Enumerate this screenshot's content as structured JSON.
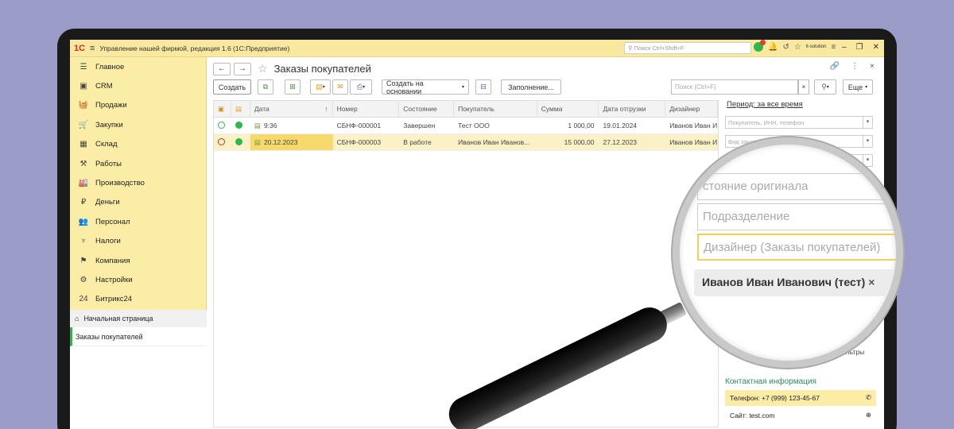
{
  "titlebar": {
    "logo": "1С",
    "app_title": "Управление нашей фирмой, редакция 1.6  (1С:Предприятие)",
    "search_placeholder": "Поиск Ctrl+Shift+F",
    "user": "it-solution"
  },
  "sidebar": {
    "items": [
      {
        "label": "Главное",
        "icon": "☰"
      },
      {
        "label": "CRM",
        "icon": "▣"
      },
      {
        "label": "Продажи",
        "icon": "🧺"
      },
      {
        "label": "Закупки",
        "icon": "🛒"
      },
      {
        "label": "Склад",
        "icon": "▦"
      },
      {
        "label": "Работы",
        "icon": "⚒"
      },
      {
        "label": "Производство",
        "icon": "🏭"
      },
      {
        "label": "Деньги",
        "icon": "₽"
      },
      {
        "label": "Персонал",
        "icon": "👥"
      },
      {
        "label": "Налоги",
        "icon": "♆"
      },
      {
        "label": "Компания",
        "icon": "⚑"
      },
      {
        "label": "Настройки",
        "icon": "⚙"
      },
      {
        "label": "Битрикс24",
        "icon": "24"
      }
    ],
    "home": "Начальная страница",
    "open_tab": "Заказы покупателей"
  },
  "header": {
    "back": "←",
    "forward": "→",
    "title": "Заказы покупателей"
  },
  "toolbar": {
    "create": "Создать",
    "create_based": "Создать на основании",
    "fill": "Заполнение...",
    "search_placeholder": "Поиск (Ctrl+F)",
    "more": "Еще"
  },
  "table": {
    "columns": [
      "",
      "",
      "Дата",
      "Номер",
      "Состояние",
      "Покупатель",
      "Сумма",
      "Дата отгрузки",
      "Дизайнер"
    ],
    "rows": [
      {
        "date": "9:36",
        "number": "СБНФ-000001",
        "status": "Завершен",
        "customer": "Тест  ООО",
        "sum": "1 000,00",
        "ship_date": "19.01.2024",
        "designer": "Иванов Иван И",
        "ring_color": "#2db84c",
        "dot_color": "#2db84c"
      },
      {
        "date": "20.12.2023",
        "number": "СБНФ-000003",
        "status": "В работе",
        "customer": "Иванов Иван Иванов...",
        "sum": "15 000,00",
        "ship_date": "27.12.2023",
        "designer": "Иванов Иван И",
        "ring_color": "#d62b1f",
        "dot_color": "#2db84c"
      }
    ]
  },
  "filters": {
    "period": "Период: за все время",
    "customer": "Покупатель, ИНН, телефон",
    "order_kind": "Вид заказа",
    "more_filters": "фильтры"
  },
  "contact": {
    "title": "Контактная информация",
    "phone": "Телефон: +7 (999) 123-45-67",
    "site": "Сайт: test.com"
  },
  "lens": {
    "field1": "стояние оригинала",
    "field2": "Подразделение",
    "field3": "Дизайнер (Заказы покупателей)",
    "chip": "Иванов Иван Иванович (тест)",
    "chip_close": "×"
  }
}
